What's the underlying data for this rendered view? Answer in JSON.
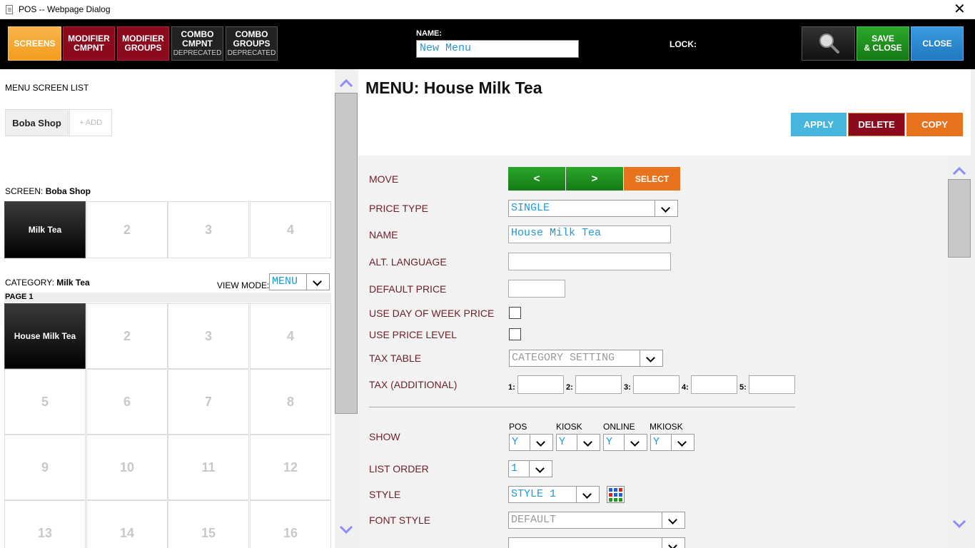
{
  "window": {
    "title": "POS -- Webpage Dialog",
    "close_glyph": "✕"
  },
  "toolbar": {
    "tabs": [
      {
        "line1": "SCREENS",
        "line2": "",
        "sub": "",
        "color": "#f5a623"
      },
      {
        "line1": "MODIFIER",
        "line2": "CMPNT",
        "sub": "",
        "color": "#8b0a1e"
      },
      {
        "line1": "MODIFIER",
        "line2": "GROUPS",
        "sub": "",
        "color": "#8b0a1e"
      },
      {
        "line1": "COMBO",
        "line2": "CMPNT",
        "sub": "DEPRECATED",
        "color": "#222222"
      },
      {
        "line1": "COMBO",
        "line2": "GROUPS",
        "sub": "DEPRECATED",
        "color": "#222222"
      }
    ],
    "name_label": "NAME:",
    "name_value": "New Menu",
    "lock_label": "LOCK:",
    "search_icon": "magnifier-icon",
    "save_line1": "SAVE",
    "save_line2": "& CLOSE",
    "close_label": "CLOSE"
  },
  "left": {
    "menu_screen_list_label": "MENU SCREEN LIST",
    "screens": [
      "Boba Shop"
    ],
    "add_label": "+ ADD",
    "screen_prefix": "SCREEN:",
    "screen_name": "Boba Shop",
    "screen_cells": [
      "Milk Tea",
      "2",
      "3",
      "4"
    ],
    "category_prefix": "CATEGORY:",
    "category_name": "Milk Tea",
    "view_mode_label": "VIEW MODE:",
    "view_mode_value": "MENU",
    "page_label": "PAGE 1",
    "page_cells": [
      "House Milk Tea",
      "2",
      "3",
      "4",
      "5",
      "6",
      "7",
      "8",
      "9",
      "10",
      "11",
      "12",
      "13",
      "14",
      "15",
      "16"
    ]
  },
  "right": {
    "title": "MENU: House Milk Tea",
    "apply_label": "APPLY",
    "delete_label": "DELETE",
    "copy_label": "COPY",
    "move_label": "MOVE",
    "move_prev": "<",
    "move_next": ">",
    "select_label": "SELECT",
    "price_type_label": "PRICE TYPE",
    "price_type_value": "SINGLE",
    "name_label": "NAME",
    "name_value": "House Milk Tea",
    "alt_language_label": "ALT. LANGUAGE",
    "alt_language_value": "",
    "default_price_label": "DEFAULT PRICE",
    "default_price_value": "",
    "use_dow_price_label": "USE DAY OF WEEK PRICE",
    "use_price_level_label": "USE PRICE LEVEL",
    "tax_table_label": "TAX TABLE",
    "tax_table_value": "CATEGORY SETTING",
    "tax_additional_label": "TAX (ADDITIONAL)",
    "tax_fields": [
      "1:",
      "2:",
      "3:",
      "4:",
      "5:"
    ],
    "show_label": "SHOW",
    "show_cols": [
      {
        "label": "POS",
        "value": "Y"
      },
      {
        "label": "KIOSK",
        "value": "Y"
      },
      {
        "label": "ONLINE",
        "value": "Y"
      },
      {
        "label": "MKIOSK",
        "value": "Y"
      }
    ],
    "list_order_label": "LIST ORDER",
    "list_order_value": "1",
    "style_label": "STYLE",
    "style_value": "STYLE 1",
    "style_grid_icon": "color-grid-icon",
    "font_style_label": "FONT STYLE",
    "font_style_value": "DEFAULT"
  },
  "colors": {
    "green": "#1f8a1f",
    "orange": "#e8731e",
    "crimson": "#8b0a1e",
    "blue": "#2b8fd6",
    "cyan": "#46b6df",
    "accent_text": "#1a9ad6"
  }
}
